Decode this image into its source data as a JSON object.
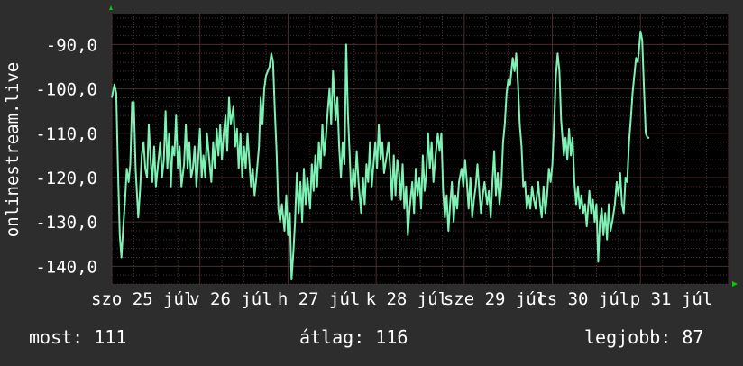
{
  "chart_data": {
    "type": "line",
    "ylabel": "onlinestream.live",
    "ylim": [
      -144,
      -83
    ],
    "yticks": [
      -90,
      -100,
      -110,
      -120,
      -130,
      -140
    ],
    "ytick_labels": [
      "-90,0",
      "-100,0",
      "-110,0",
      "-120,0",
      "-130,0",
      "-140,0"
    ],
    "x_range": [
      0,
      7
    ],
    "x_tick_labels": [
      {
        "x": 0.35,
        "label": "szo 25 júl"
      },
      {
        "x": 1.35,
        "label": "v 26 júl"
      },
      {
        "x": 2.35,
        "label": "h 27 júl"
      },
      {
        "x": 3.35,
        "label": "k 28 júl"
      },
      {
        "x": 4.35,
        "label": "sze 29 júl"
      },
      {
        "x": 5.35,
        "label": "cs 30 júl"
      },
      {
        "x": 6.35,
        "label": "p 31 júl"
      }
    ],
    "grid": true,
    "colors": {
      "line": "#7ef2b4",
      "background": "#000000",
      "grid": "#4a2f2f",
      "frame": "#2d2d2d"
    },
    "series": [
      {
        "values": [
          [
            0.0,
            -102
          ],
          [
            0.03,
            -99
          ],
          [
            0.05,
            -101
          ],
          [
            0.07,
            -118
          ],
          [
            0.09,
            -133
          ],
          [
            0.11,
            -138
          ],
          [
            0.13,
            -131
          ],
          [
            0.15,
            -125
          ],
          [
            0.17,
            -118
          ],
          [
            0.19,
            -121
          ],
          [
            0.21,
            -117
          ],
          [
            0.23,
            -103
          ],
          [
            0.25,
            -103
          ],
          [
            0.27,
            -118
          ],
          [
            0.3,
            -129
          ],
          [
            0.32,
            -123
          ],
          [
            0.34,
            -115
          ],
          [
            0.36,
            -112
          ],
          [
            0.38,
            -118
          ],
          [
            0.4,
            -120
          ],
          [
            0.42,
            -108
          ],
          [
            0.44,
            -116
          ],
          [
            0.46,
            -121
          ],
          [
            0.48,
            -113
          ],
          [
            0.5,
            -122
          ],
          [
            0.52,
            -118
          ],
          [
            0.55,
            -112
          ],
          [
            0.57,
            -120
          ],
          [
            0.59,
            -116
          ],
          [
            0.61,
            -105
          ],
          [
            0.63,
            -118
          ],
          [
            0.65,
            -110
          ],
          [
            0.67,
            -122
          ],
          [
            0.69,
            -113
          ],
          [
            0.71,
            -115
          ],
          [
            0.73,
            -106
          ],
          [
            0.75,
            -118
          ],
          [
            0.77,
            -113
          ],
          [
            0.79,
            -122
          ],
          [
            0.82,
            -117
          ],
          [
            0.84,
            -108
          ],
          [
            0.86,
            -118
          ],
          [
            0.88,
            -112
          ],
          [
            0.9,
            -120
          ],
          [
            0.92,
            -118
          ],
          [
            0.94,
            -113
          ],
          [
            0.96,
            -122
          ],
          [
            0.98,
            -116
          ],
          [
            1.0,
            -109
          ],
          [
            1.02,
            -120
          ],
          [
            1.04,
            -115
          ],
          [
            1.06,
            -120
          ],
          [
            1.08,
            -110
          ],
          [
            1.11,
            -117
          ],
          [
            1.13,
            -121
          ],
          [
            1.15,
            -112
          ],
          [
            1.17,
            -118
          ],
          [
            1.19,
            -109
          ],
          [
            1.21,
            -115
          ],
          [
            1.23,
            -108
          ],
          [
            1.25,
            -116
          ],
          [
            1.27,
            -110
          ],
          [
            1.29,
            -106
          ],
          [
            1.31,
            -114
          ],
          [
            1.33,
            -102
          ],
          [
            1.35,
            -108
          ],
          [
            1.38,
            -104
          ],
          [
            1.4,
            -113
          ],
          [
            1.42,
            -109
          ],
          [
            1.44,
            -118
          ],
          [
            1.46,
            -110
          ],
          [
            1.48,
            -120
          ],
          [
            1.5,
            -113
          ],
          [
            1.52,
            -118
          ],
          [
            1.54,
            -110
          ],
          [
            1.56,
            -116
          ],
          [
            1.58,
            -122
          ],
          [
            1.6,
            -118
          ],
          [
            1.62,
            -124
          ],
          [
            1.64,
            -120
          ],
          [
            1.67,
            -113
          ],
          [
            1.69,
            -102
          ],
          [
            1.71,
            -108
          ],
          [
            1.73,
            -100
          ],
          [
            1.75,
            -97
          ],
          [
            1.77,
            -96
          ],
          [
            1.79,
            -95
          ],
          [
            1.81,
            -92
          ],
          [
            1.83,
            -94
          ],
          [
            1.85,
            -105
          ],
          [
            1.87,
            -114
          ],
          [
            1.89,
            -127
          ],
          [
            1.91,
            -130
          ],
          [
            1.93,
            -126
          ],
          [
            1.96,
            -132
          ],
          [
            1.98,
            -124
          ],
          [
            2.0,
            -133
          ],
          [
            2.02,
            -128
          ],
          [
            2.04,
            -143
          ],
          [
            2.06,
            -137
          ],
          [
            2.08,
            -130
          ],
          [
            2.1,
            -119
          ],
          [
            2.12,
            -128
          ],
          [
            2.14,
            -121
          ],
          [
            2.16,
            -130
          ],
          [
            2.18,
            -118
          ],
          [
            2.2,
            -126
          ],
          [
            2.22,
            -120
          ],
          [
            2.25,
            -127
          ],
          [
            2.27,
            -117
          ],
          [
            2.29,
            -123
          ],
          [
            2.31,
            -115
          ],
          [
            2.33,
            -122
          ],
          [
            2.35,
            -112
          ],
          [
            2.37,
            -118
          ],
          [
            2.39,
            -108
          ],
          [
            2.41,
            -115
          ],
          [
            2.43,
            -111
          ],
          [
            2.45,
            -105
          ],
          [
            2.47,
            -100
          ],
          [
            2.49,
            -108
          ],
          [
            2.51,
            -96
          ],
          [
            2.54,
            -107
          ],
          [
            2.56,
            -102
          ],
          [
            2.58,
            -113
          ],
          [
            2.6,
            -120
          ],
          [
            2.62,
            -112
          ],
          [
            2.64,
            -117
          ],
          [
            2.66,
            -90
          ],
          [
            2.68,
            -106
          ],
          [
            2.7,
            -115
          ],
          [
            2.72,
            -125
          ],
          [
            2.74,
            -118
          ],
          [
            2.76,
            -122
          ],
          [
            2.78,
            -114
          ],
          [
            2.8,
            -121
          ],
          [
            2.83,
            -128
          ],
          [
            2.85,
            -120
          ],
          [
            2.87,
            -126
          ],
          [
            2.89,
            -117
          ],
          [
            2.91,
            -121
          ],
          [
            2.93,
            -112
          ],
          [
            2.95,
            -122
          ],
          [
            2.97,
            -117
          ],
          [
            2.99,
            -112
          ],
          [
            3.01,
            -118
          ],
          [
            3.03,
            -108
          ],
          [
            3.05,
            -116
          ],
          [
            3.07,
            -112
          ],
          [
            3.09,
            -119
          ],
          [
            3.12,
            -115
          ],
          [
            3.14,
            -112
          ],
          [
            3.16,
            -118
          ],
          [
            3.18,
            -125
          ],
          [
            3.2,
            -115
          ],
          [
            3.22,
            -124
          ],
          [
            3.24,
            -116
          ],
          [
            3.26,
            -119
          ],
          [
            3.28,
            -125
          ],
          [
            3.3,
            -117
          ],
          [
            3.32,
            -127
          ],
          [
            3.34,
            -122
          ],
          [
            3.36,
            -133
          ],
          [
            3.38,
            -127
          ],
          [
            3.41,
            -121
          ],
          [
            3.43,
            -128
          ],
          [
            3.45,
            -118
          ],
          [
            3.47,
            -124
          ],
          [
            3.49,
            -120
          ],
          [
            3.51,
            -127
          ],
          [
            3.53,
            -115
          ],
          [
            3.55,
            -123
          ],
          [
            3.57,
            -119
          ],
          [
            3.59,
            -110
          ],
          [
            3.61,
            -118
          ],
          [
            3.63,
            -112
          ],
          [
            3.65,
            -121
          ],
          [
            3.67,
            -116
          ],
          [
            3.7,
            -110
          ],
          [
            3.72,
            -114
          ],
          [
            3.74,
            -110
          ],
          [
            3.76,
            -123
          ],
          [
            3.78,
            -129
          ],
          [
            3.8,
            -124
          ],
          [
            3.82,
            -132
          ],
          [
            3.84,
            -126
          ],
          [
            3.86,
            -121
          ],
          [
            3.88,
            -130
          ],
          [
            3.9,
            -124
          ],
          [
            3.92,
            -127
          ],
          [
            3.94,
            -121
          ],
          [
            3.97,
            -118
          ],
          [
            3.99,
            -122
          ],
          [
            4.01,
            -116
          ],
          [
            4.03,
            -121
          ],
          [
            4.05,
            -127
          ],
          [
            4.07,
            -120
          ],
          [
            4.09,
            -129
          ],
          [
            4.11,
            -125
          ],
          [
            4.13,
            -122
          ],
          [
            4.15,
            -117
          ],
          [
            4.17,
            -123
          ],
          [
            4.19,
            -128
          ],
          [
            4.21,
            -124
          ],
          [
            4.23,
            -121
          ],
          [
            4.26,
            -126
          ],
          [
            4.28,
            -123
          ],
          [
            4.3,
            -129
          ],
          [
            4.32,
            -121
          ],
          [
            4.34,
            -114
          ],
          [
            4.36,
            -124
          ],
          [
            4.38,
            -119
          ],
          [
            4.4,
            -126
          ],
          [
            4.42,
            -122
          ],
          [
            4.44,
            -112
          ],
          [
            4.46,
            -108
          ],
          [
            4.48,
            -101
          ],
          [
            4.5,
            -98
          ],
          [
            4.52,
            -99
          ],
          [
            4.55,
            -93
          ],
          [
            4.57,
            -96
          ],
          [
            4.59,
            -92
          ],
          [
            4.61,
            -99
          ],
          [
            4.63,
            -108
          ],
          [
            4.65,
            -113
          ],
          [
            4.67,
            -122
          ],
          [
            4.69,
            -121
          ],
          [
            4.71,
            -127
          ],
          [
            4.73,
            -124
          ],
          [
            4.75,
            -127
          ],
          [
            4.77,
            -122
          ],
          [
            4.79,
            -125
          ],
          [
            4.81,
            -127
          ],
          [
            4.84,
            -121
          ],
          [
            4.86,
            -126
          ],
          [
            4.88,
            -129
          ],
          [
            4.9,
            -122
          ],
          [
            4.92,
            -128
          ],
          [
            4.94,
            -124
          ],
          [
            4.96,
            -118
          ],
          [
            4.98,
            -121
          ],
          [
            5.0,
            -117
          ],
          [
            5.02,
            -108
          ],
          [
            5.04,
            -97
          ],
          [
            5.06,
            -92
          ],
          [
            5.08,
            -96
          ],
          [
            5.1,
            -107
          ],
          [
            5.13,
            -115
          ],
          [
            5.15,
            -111
          ],
          [
            5.17,
            -116
          ],
          [
            5.19,
            -109
          ],
          [
            5.21,
            -115
          ],
          [
            5.23,
            -111
          ],
          [
            5.25,
            -121
          ],
          [
            5.27,
            -126
          ],
          [
            5.29,
            -122
          ],
          [
            5.31,
            -127
          ],
          [
            5.33,
            -124
          ],
          [
            5.35,
            -128
          ],
          [
            5.37,
            -126
          ],
          [
            5.39,
            -131
          ],
          [
            5.42,
            -123
          ],
          [
            5.44,
            -128
          ],
          [
            5.46,
            -125
          ],
          [
            5.48,
            -130
          ],
          [
            5.5,
            -126
          ],
          [
            5.52,
            -139
          ],
          [
            5.54,
            -130
          ],
          [
            5.56,
            -127
          ],
          [
            5.58,
            -133
          ],
          [
            5.6,
            -128
          ],
          [
            5.62,
            -134
          ],
          [
            5.64,
            -126
          ],
          [
            5.66,
            -132
          ],
          [
            5.68,
            -130
          ],
          [
            5.71,
            -126
          ],
          [
            5.73,
            -121
          ],
          [
            5.75,
            -124
          ],
          [
            5.77,
            -119
          ],
          [
            5.79,
            -126
          ],
          [
            5.81,
            -128
          ],
          [
            5.83,
            -120
          ],
          [
            5.85,
            -121
          ],
          [
            5.87,
            -112
          ],
          [
            5.89,
            -107
          ],
          [
            5.91,
            -101
          ],
          [
            5.93,
            -97
          ],
          [
            5.95,
            -93
          ],
          [
            5.97,
            -94
          ],
          [
            6.0,
            -87
          ],
          [
            6.02,
            -89
          ],
          [
            6.04,
            -100
          ],
          [
            6.06,
            -110
          ],
          [
            6.08,
            -111
          ],
          [
            6.1,
            -111
          ]
        ]
      }
    ]
  },
  "stats": {
    "current": "most: 111",
    "average": "átlag: 116",
    "best": "legjobb: 87"
  }
}
